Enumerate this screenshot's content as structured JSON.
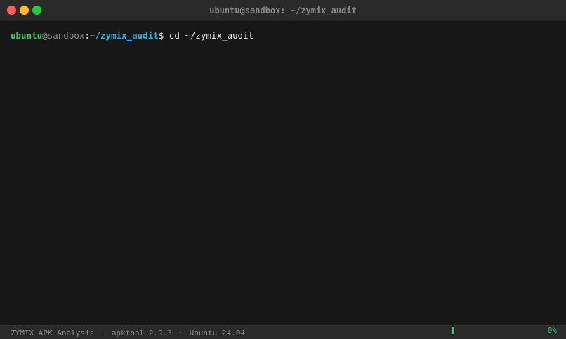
{
  "window": {
    "title": "ubuntu@sandbox: ~/zymix_audit",
    "controls": [
      "close",
      "minimize",
      "maximize"
    ]
  },
  "terminal": {
    "prompt": {
      "user": "ubuntu",
      "at": "@",
      "host": "sandbox",
      "colon": ":",
      "path": "~/zymix_audit",
      "dollar": "$"
    },
    "command": " cd ~/zymix_audit"
  },
  "statusbar": {
    "items": [
      "ZYMIX APK Analysis",
      "apktool 2.9.3",
      "Ubuntu 24.04"
    ],
    "separator": "·",
    "progress_label": "0%",
    "progress_value": 0
  },
  "colors": {
    "background": "#171717",
    "titlebar": "#2a2a2a",
    "user": "#4fc26b",
    "path": "#47a8d8",
    "accent": "#3ec46d"
  }
}
